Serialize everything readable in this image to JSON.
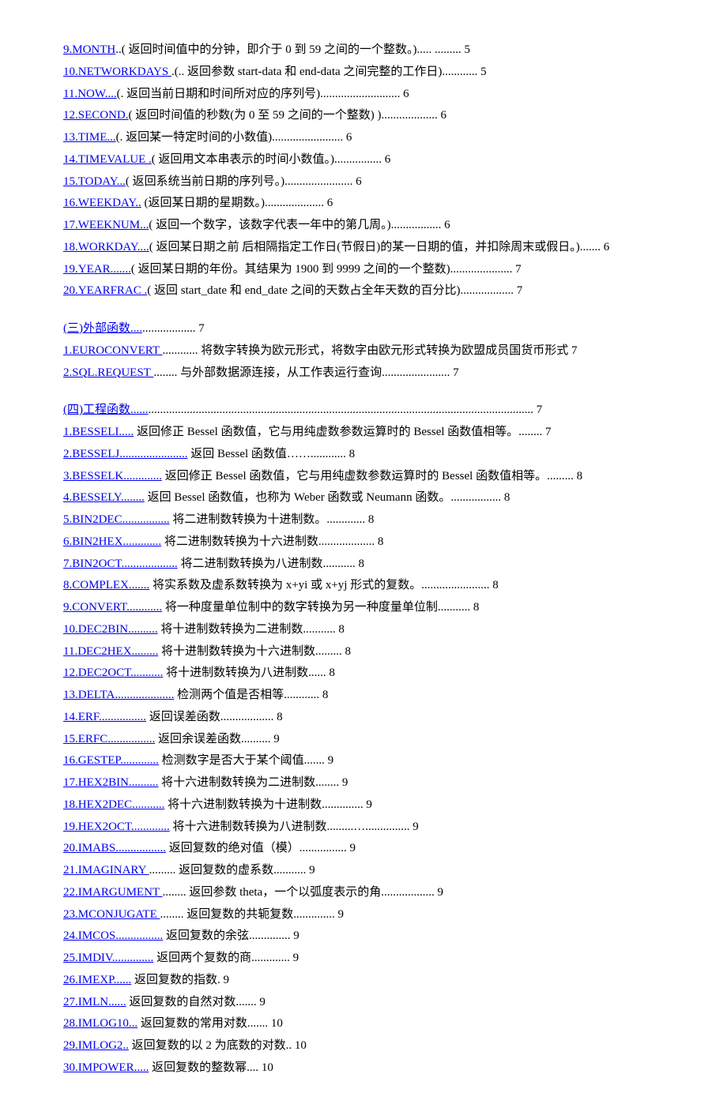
{
  "block1": [
    {
      "link": "9.MONTH",
      "desc": "..(  返回时间值中的分钟，即介于 0 到 59 之间的一个整数。)..... ......... 5"
    },
    {
      "link": "10.NETWORKDAYS ",
      "desc": ".(..  返回参数 start-data  和 end-data  之间完整的工作日)............ 5"
    },
    {
      "link": "11.NOW....",
      "desc": "(.  返回当前日期和时间所对应的序列号)........................... 6"
    },
    {
      "link": "12.SECOND.",
      "desc": "(  返回时间值的秒数(为 0 至 59  之间的一个整数) )................... 6"
    },
    {
      "link": "13.TIME...",
      "desc": "(.  返回某一特定时间的小数值)........................ 6"
    },
    {
      "link": "14.TIMEVALUE .",
      "desc": "(  返回用文本串表示的时间小数值。)................ 6"
    },
    {
      "link": "15.TODAY...",
      "desc": "(  返回系统当前日期的序列号。)....................... 6"
    },
    {
      "link": "16.WEEKDAY..",
      "desc": " (返回某日期的星期数。).................... 6"
    },
    {
      "link": "17.WEEKNUM...",
      "desc": "(  返回一个数字，该数字代表一年中的第几周。)................. 6"
    },
    {
      "link": "18.WORKDAY....",
      "desc": "(  返回某日期之前  后相隔指定工作日(节假日)的某一日期的值，并扣除周末或假日。)....... 6"
    },
    {
      "link": "19.YEAR.......",
      "desc": "(  返回某日期的年份。其结果为 1900  到 9999  之间的一个整数)..................... 7"
    },
    {
      "link": "20.YEARFRAC .",
      "desc": "(  返回 start_date  和 end_date  之间的天数占全年天数的百分比).................. 7"
    }
  ],
  "section3": {
    "link": "(三)外部函数....",
    "desc": ".................. 7"
  },
  "block3": [
    {
      "link": "1.EUROCONVERT ",
      "desc": "............  将数字转换为欧元形式，将数字由欧元形式转换为欧盟成员国货币形式    7"
    },
    {
      "link": "2.SQL.REQUEST ",
      "desc": "........  与外部数据源连接，从工作表运行查询....................... 7"
    }
  ],
  "section4": {
    "link": "(四)工程函数......",
    "desc": "..................................................................................................................................  7"
  },
  "block4": [
    {
      "link": "1.BESSELI.....",
      "desc": " 返回修正 Bessel  函数值，它与用纯虚数参数运算时的 Bessel  函数值相等。........ 7"
    },
    {
      "link": "2.BESSELJ.......................",
      "desc": "  返回  Bessel  函数值……............ 8"
    },
    {
      "link": "3.BESSELK.............",
      "desc": "  返回修正 Bessel  函数值，它与用纯虚数参数运算时的 Bessel  函数值相等。......... 8"
    },
    {
      "link": "4.BESSELY........",
      "desc": "  返回 Bessel  函数值，也称为 Weber  函数或 Neumann  函数。................. 8"
    },
    {
      "link": "5.BIN2DEC................",
      "desc": "  将二进制数转换为十进制数。............. 8"
    },
    {
      "link": "6.BIN2HEX.............",
      "desc": "  将二进制数转换为十六进制数................... 8"
    },
    {
      "link": "7.BIN2OCT...................",
      "desc": "  将二进制数转换为八进制数........... 8"
    },
    {
      "link": "8.COMPLEX.......",
      "desc": "  将实系数及虚系数转换为  x+yi  或  x+yj  形式的复数。....................... 8"
    },
    {
      "link": "9.CONVERT............",
      "desc": "  将一种度量单位制中的数字转换为另一种度量单位制........... 8"
    },
    {
      "link": "10.DEC2BIN..........",
      "desc": "  将十进制数转换为二进制数........... 8"
    },
    {
      "link": "11.DEC2HEX.........",
      "desc": "  将十进制数转换为十六进制数......... 8"
    },
    {
      "link": "12.DEC2OCT...........",
      "desc": "  将十进制数转换为八进制数...... 8"
    },
    {
      "link": "13.DELTA....................",
      "desc": "  检测两个值是否相等............ 8"
    },
    {
      "link": "14.ERF................",
      "desc": "  返回误差函数.................. 8"
    },
    {
      "link": "15.ERFC................",
      "desc": "  返回余误差函数.......... 9"
    },
    {
      "link": "16.GESTEP.............",
      "desc": "  检测数字是否大于某个阈值....... 9"
    },
    {
      "link": "17.HEX2BIN..........",
      "desc": "  将十六进制数转换为二进制数........ 9"
    },
    {
      "link": "18.HEX2DEC...........",
      "desc": "    将十六进制数转换为十进制数.............. 9"
    },
    {
      "link": "19.HEX2OCT.............",
      "desc": "  将十六进制数转换为八进制数.........…............... 9"
    },
    {
      "link": "20.IMABS.................",
      "desc": "  返回复数的绝对值（模）................ 9"
    },
    {
      "link": "21.IMAGINARY ",
      "desc": ".........  返回复数的虚系数........... 9"
    },
    {
      "link": "22.IMARGUMENT ",
      "desc": "........  返回参数  theta，一个以弧度表示的角.................. 9"
    },
    {
      "link": "23.MCONJUGATE ",
      "desc": "........  返回复数的共轭复数.............. 9"
    },
    {
      "link": "24.IMCOS................",
      "desc": "  返回复数的余弦.............. 9"
    },
    {
      "link": "25.IMDIV..............",
      "desc": "  返回两个复数的商............. 9"
    },
    {
      "link": "26.IMEXP......",
      "desc": "  返回复数的指数. 9"
    },
    {
      "link": "27.IMLN......",
      "desc": "  返回复数的自然对数....... 9"
    },
    {
      "link": "28.IMLOG10...",
      "desc": "  返回复数的常用对数....... 10"
    },
    {
      "link": "29.IMLOG2..",
      "desc": "  返回复数的以  2  为底数的对数.. 10"
    },
    {
      "link": "30.IMPOWER.....",
      "desc": "  返回复数的整数幂.... 10"
    }
  ]
}
